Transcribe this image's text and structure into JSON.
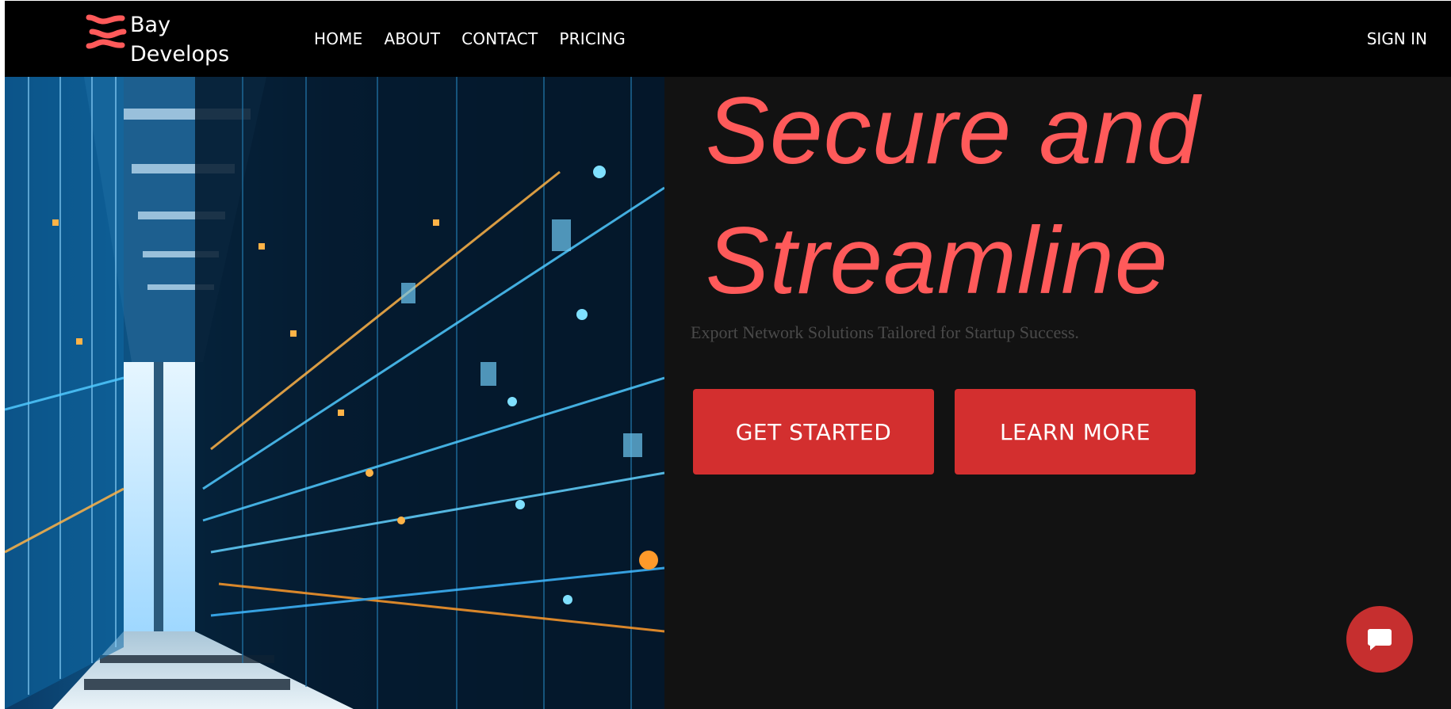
{
  "navbar": {
    "brand_line1": "Bay",
    "brand_line2": "Develops",
    "links": [
      {
        "label": "HOME"
      },
      {
        "label": "ABOUT"
      },
      {
        "label": "CONTACT"
      },
      {
        "label": "PRICING"
      }
    ],
    "sign_in": "SIGN IN"
  },
  "hero": {
    "headline_line1": "Secure and",
    "headline_line2": "Streamline",
    "subtitle": "Export Network Solutions Tailored for Startup Success.",
    "primary_button": "GET STARTED",
    "secondary_button": "LEARN MORE",
    "image_icon": "data-center-corridor-image"
  },
  "chat": {
    "icon": "chat-bubble-icon"
  },
  "colors": {
    "accent": "#ff5a5a",
    "button": "#d32f2f",
    "background": "#121212",
    "navbar": "#000000"
  }
}
